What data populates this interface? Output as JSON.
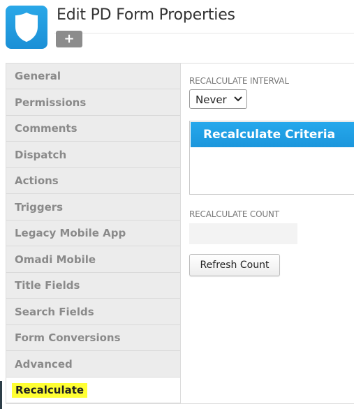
{
  "header": {
    "title": "Edit PD Form Properties",
    "add_label": "+",
    "logo_icon": "shield-icon",
    "brand_color": "#1b8fd6"
  },
  "sidebar": {
    "items": [
      {
        "label": "General"
      },
      {
        "label": "Permissions"
      },
      {
        "label": "Comments"
      },
      {
        "label": "Dispatch"
      },
      {
        "label": "Actions"
      },
      {
        "label": "Triggers"
      },
      {
        "label": "Legacy Mobile App"
      },
      {
        "label": "Omadi Mobile"
      },
      {
        "label": "Title Fields"
      },
      {
        "label": "Search Fields"
      },
      {
        "label": "Form Conversions"
      },
      {
        "label": "Advanced"
      },
      {
        "label": "Recalculate"
      }
    ],
    "active": "Recalculate",
    "highlight_color": "#ffff33"
  },
  "main": {
    "interval_label": "RECALCULATE INTERVAL",
    "interval_value": "Never",
    "criteria_title": "Recalculate Criteria",
    "criteria_color": "#1b96dc",
    "count_label": "RECALCULATE COUNT",
    "count_value": "",
    "refresh_label": "Refresh Count"
  }
}
